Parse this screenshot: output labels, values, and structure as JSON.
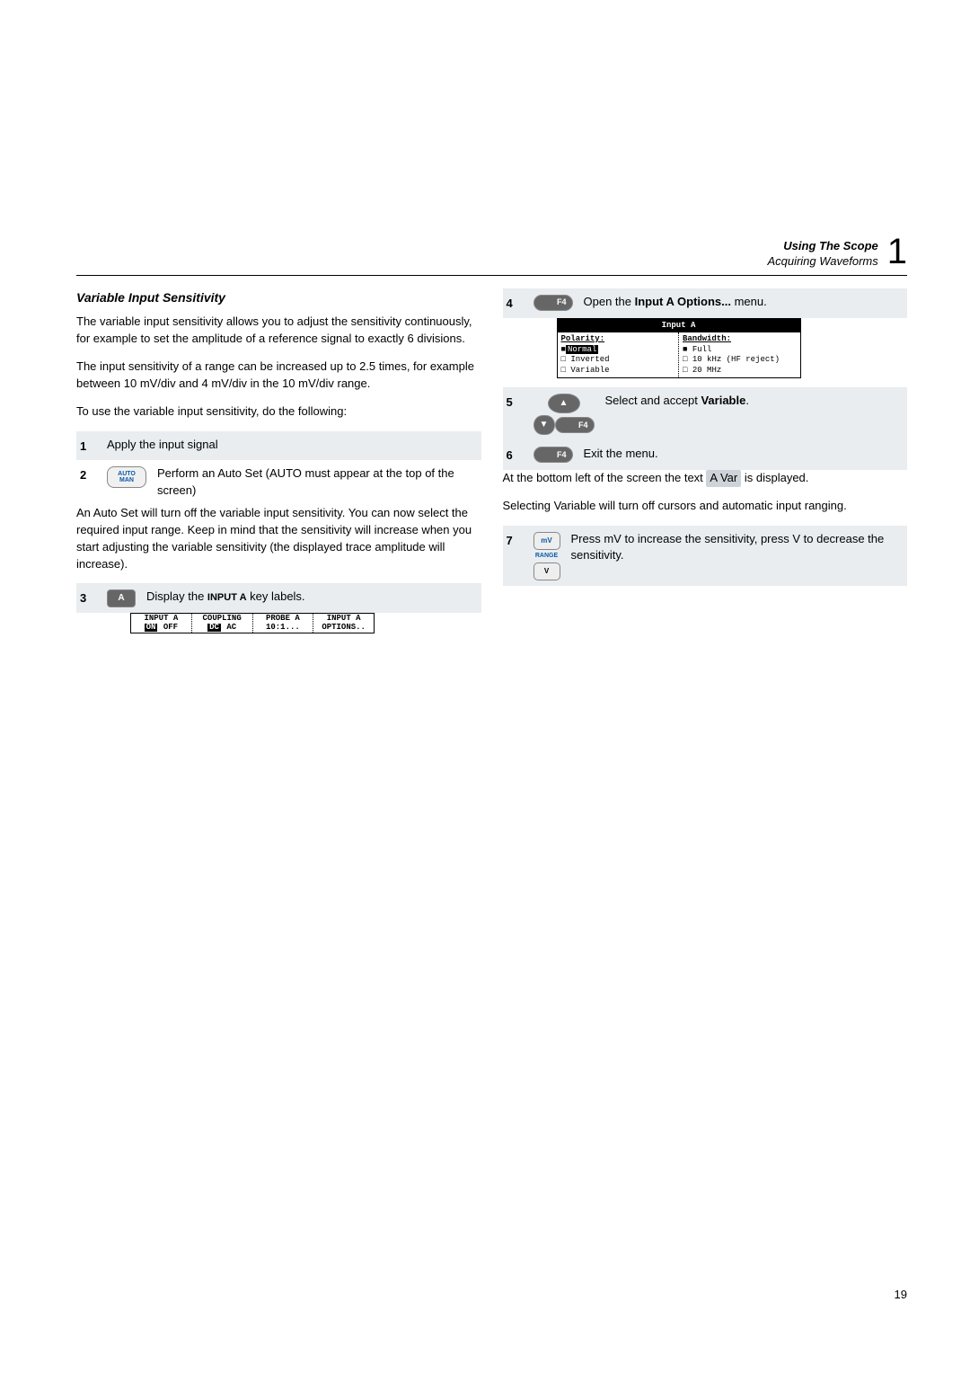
{
  "header": {
    "title": "Using The Scope",
    "subtitle": "Acquiring Waveforms",
    "chapter": "1"
  },
  "left": {
    "section_title": "Variable Input Sensitivity",
    "p1": "The variable input sensitivity allows you to adjust the sensitivity continuously, for example to set the amplitude of a reference signal to exactly 6 divisions.",
    "p2": "The input sensitivity of a range can be increased up to 2.5 times, for example between 10 mV/div and 4 mV/div in the 10 mV/div range.",
    "p3": "To use the variable input sensitivity, do the following:",
    "step1": {
      "num": "1",
      "text": "Apply the input signal"
    },
    "step2": {
      "num": "2",
      "key_top": "AUTO",
      "key_bot": "MAN",
      "text": "Perform an Auto Set (AUTO must appear at the top of the screen)"
    },
    "p4": "An Auto Set will turn off the variable input sensitivity.  You can now select the required input range.  Keep in mind that the sensitivity will increase when you start adjusting the variable sensitivity (the displayed trace amplitude will increase).",
    "step3": {
      "num": "3",
      "key": "A",
      "text_pre": "Display the ",
      "text_strong": "INPUT A",
      "text_post": " key labels."
    },
    "softkeys": {
      "c1a": "INPUT A",
      "c1b_inv": "ON",
      "c1b": " OFF",
      "c2a": "COUPLING",
      "c2b_inv": "DC",
      "c2b": " AC",
      "c3a": "PROBE A",
      "c3b": "10:1...",
      "c4a": "INPUT A",
      "c4b": "OPTIONS.."
    }
  },
  "right": {
    "step4": {
      "num": "4",
      "key": "F4",
      "text_pre": "Open the ",
      "text_strong": "Input A Options...",
      "text_post": " menu."
    },
    "menu": {
      "title": "Input A",
      "polarity_hdr": "Polarity:",
      "polarity_opts": [
        "Normal",
        "Inverted",
        "Variable"
      ],
      "bw_hdr": "Bandwidth:",
      "bw_opts": [
        "Full",
        "10 kHz (HF reject)",
        "20 MHz"
      ]
    },
    "step5": {
      "num": "5",
      "key": "F4",
      "text_pre": "Select and accept ",
      "text_strong": "Variable",
      "text_post": "."
    },
    "step6": {
      "num": "6",
      "key": "F4",
      "text": "Exit the menu."
    },
    "p_bottom_pre": "At the bottom left of the screen the text ",
    "p_bottom_badge": "A  Var",
    "p_bottom_post": " is displayed.",
    "p_sel": "Selecting Variable will turn off cursors and automatic input ranging.",
    "step7": {
      "num": "7",
      "key_mv": "mV",
      "key_range": "RANGE",
      "key_v": "V",
      "text": "Press mV to increase the sensitivity, press V to decrease the sensitivity."
    }
  },
  "page_number": "19"
}
